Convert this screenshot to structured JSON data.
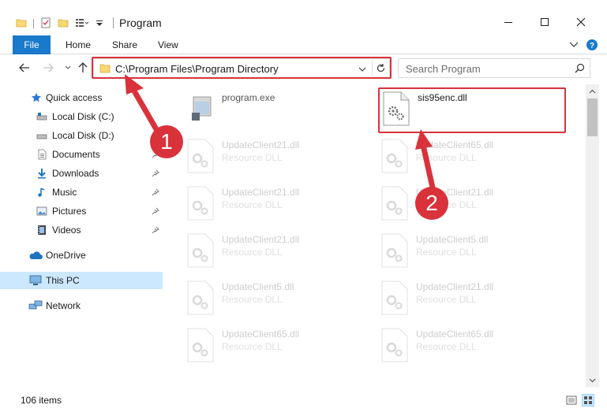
{
  "window": {
    "title": "Program",
    "minimize_icon": "minimize-icon",
    "maximize_icon": "maximize-icon",
    "close_icon": "close-icon"
  },
  "ribbon": {
    "tabs": [
      {
        "label": "File"
      },
      {
        "label": "Home"
      },
      {
        "label": "Share"
      },
      {
        "label": "View"
      }
    ]
  },
  "address": {
    "path": "C:\\Program Files\\Program Directory"
  },
  "search": {
    "placeholder": "Search Program"
  },
  "sidebar": {
    "items": [
      {
        "label": "Quick access",
        "icon": "star-icon"
      },
      {
        "label": "Local Disk (C:)",
        "icon": "drive-icon"
      },
      {
        "label": "Local Disk (D:)",
        "icon": "drive-icon"
      },
      {
        "label": "Documents",
        "icon": "documents-icon",
        "pinned": true
      },
      {
        "label": "Downloads",
        "icon": "downloads-icon",
        "pinned": true
      },
      {
        "label": "Music",
        "icon": "music-icon",
        "pinned": true
      },
      {
        "label": "Pictures",
        "icon": "pictures-icon",
        "pinned": true
      },
      {
        "label": "Videos",
        "icon": "videos-icon",
        "pinned": true
      },
      {
        "label": "OneDrive",
        "icon": "cloud-icon"
      },
      {
        "label": "This PC",
        "icon": "computer-icon",
        "selected": true
      },
      {
        "label": "Network",
        "icon": "network-icon"
      }
    ]
  },
  "files": [
    {
      "name": "program.exe",
      "type": ""
    },
    {
      "name": "sis95enc.dll",
      "type": "",
      "highlighted": true
    },
    {
      "name": "UpdateClient21.dll",
      "type": "Resource DLL"
    },
    {
      "name": "UpdateClient65.dll",
      "type": "Resource DLL"
    },
    {
      "name": "UpdateClient21.dll",
      "type": "Resource DLL"
    },
    {
      "name": "UpdateClient21.dll",
      "type": "Resource DLL"
    },
    {
      "name": "UpdateClient21.dll",
      "type": "Resource DLL"
    },
    {
      "name": "UpdateClient5.dll",
      "type": "Resource DLL"
    },
    {
      "name": "UpdateClient5.dll",
      "type": "Resource DLL"
    },
    {
      "name": "UpdateClient21.dll",
      "type": "Resource DLL"
    },
    {
      "name": "UpdateClient65.dll",
      "type": "Resource DLL"
    },
    {
      "name": "UpdateClient65.dll",
      "type": "Resource DLL"
    }
  ],
  "status": {
    "item_count": "106 items"
  },
  "callouts": [
    {
      "label": "1"
    },
    {
      "label": "2"
    }
  ],
  "colors": {
    "accent": "#1979ca",
    "annotation": "#d9323b",
    "selection": "#cce8ff"
  }
}
